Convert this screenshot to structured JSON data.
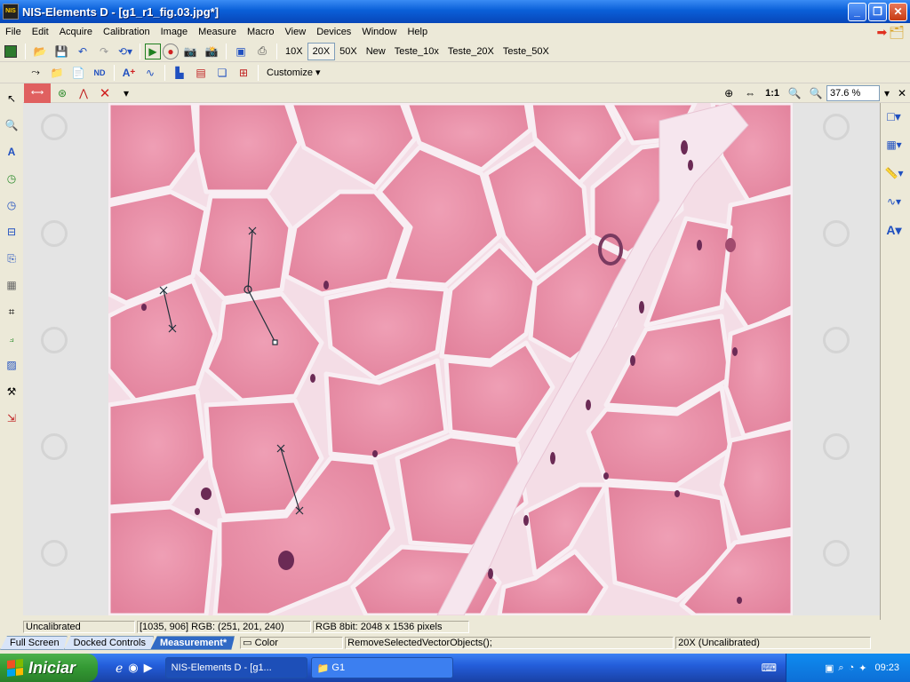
{
  "window": {
    "title": "NIS-Elements D  - [g1_r1_fig.03.jpg*]",
    "app_icon_text": "NIS"
  },
  "menu": {
    "items": [
      "File",
      "Edit",
      "Acquire",
      "Calibration",
      "Image",
      "Measure",
      "Macro",
      "View",
      "Devices",
      "Window",
      "Help"
    ]
  },
  "toolbar1": {
    "objective_buttons": [
      "10X",
      "20X",
      "50X",
      "New",
      "Teste_10x",
      "Teste_20X",
      "Teste_50X"
    ],
    "active_objective": "20X"
  },
  "toolbar2": {
    "customize_label": "Customize"
  },
  "toolbar3": {
    "zoom_one_to_one": "1:1",
    "zoom_value": "37.6 %"
  },
  "status": {
    "calibration": "Uncalibrated",
    "pixel_info": "[1035, 906] RGB: (251, 201, 240)",
    "image_info": "RGB 8bit: 2048 x 1536 pixels"
  },
  "bottom_tabs": [
    "Full Screen",
    "Docked Controls",
    "Measurement*"
  ],
  "active_bottom_tab": "Measurement*",
  "bottom_status": {
    "color_label": "Color",
    "command": "RemoveSelectedVectorObjects();",
    "objective": "20X (Uncalibrated)"
  },
  "taskbar": {
    "start_label": "Iniciar",
    "tasks": [
      "NIS-Elements D - [g1...",
      "G1"
    ],
    "clock": "09:23"
  },
  "colors": {
    "tissue_pink": "#e98aa4",
    "membrane": "#f7ecf2",
    "nucleus": "#6b2a55"
  }
}
